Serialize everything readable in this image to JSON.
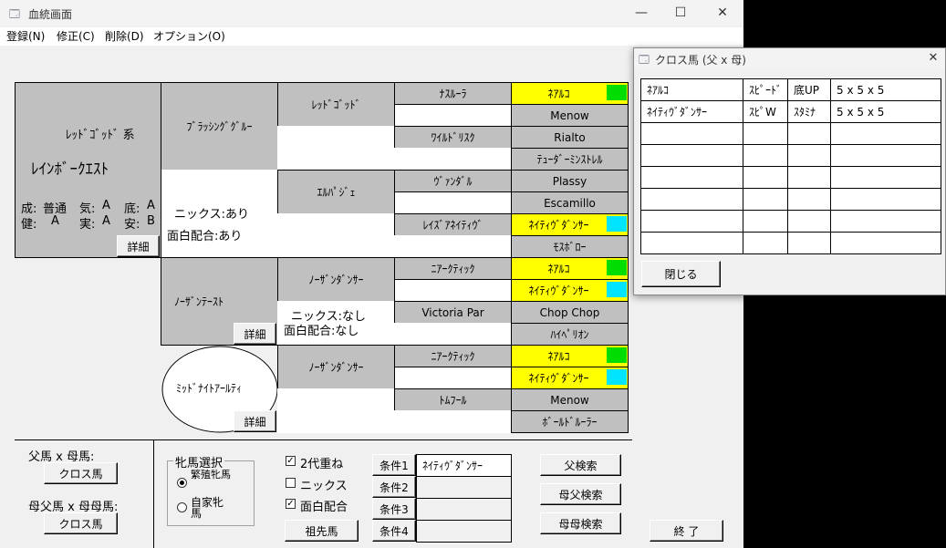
{
  "main": {
    "title": "血統画面",
    "icon": "app-window-icon",
    "controls": {
      "minimize": "—",
      "maximize": "☐",
      "close": "✕"
    },
    "menu": [
      "登録(N)",
      "修正(C)",
      "削除(D)",
      "オプション(O)"
    ]
  },
  "horse": {
    "lineage": "ﾚｯﾄﾞｺﾞｯﾄﾞ 系",
    "name": "ﾚｲﾝﾎﾞｰｸｴｽﾄ",
    "stats": {
      "seiLabel": "成:",
      "seiVal": "普通",
      "kiLabel": "気:",
      "kiVal": "A",
      "teiLabel": "底:",
      "teiVal": "A",
      "kenLabel": "健:",
      "kenVal": "A",
      "jitsuLabel": "実:",
      "jitsuVal": "A",
      "anLabel": "安:",
      "anVal": "B"
    },
    "detail": "詳細"
  },
  "sire": {
    "name": "ﾌﾞﾗｯｼﾝｸﾞｸﾞﾙｰ",
    "nicks": "ニックス:あり",
    "omoshiro": "面白配合:あり",
    "gen2": {
      "sire": "ﾚｯﾄﾞｺﾞｯﾄﾞ",
      "dam": "ｴﾙﾊﾟｼﾞｪ"
    },
    "gen3": {
      "ss": "ﾅｽﾙｰﾗ",
      "sd": "ﾜｲﾙﾄﾞﾘｽｸ",
      "ds": "ｳﾞｧﾝﾀﾞﾙ",
      "dd": "ﾚｲｽﾞｱﾈｲﾃｨｳﾞ"
    }
  },
  "dam": {
    "name": "ﾉｰｻﾞﾝﾃｰｽﾄ",
    "nicks": "ニックス:なし",
    "omoshiro": "面白配合:なし",
    "detail": "詳細",
    "gen2": {
      "sire": "ﾉｰｻﾞﾝﾀﾞﾝｻｰ"
    },
    "gen3": {
      "ss": "ﾆｱｰｸﾃｨｯｸ",
      "sd": "Victoria Par"
    }
  },
  "damdam": {
    "name": "ﾐｯﾄﾞﾅｲﾄｱｰﾙﾃｨ",
    "detail": "詳細",
    "gen2": {
      "sire": "ﾉｰｻﾞﾝﾀﾞﾝｻｰ"
    },
    "gen3": {
      "ss": "ﾆｱｰｸﾃｨｯｸ",
      "sd": "ﾄﾑﾌｰﾙ"
    }
  },
  "gen4": [
    "ﾈｱﾙｺ",
    "Menow",
    "Rialto",
    "ﾃｭｰﾀﾞｰﾐﾝｽﾄﾚﾙ",
    "Plassy",
    "Escamillo",
    "ﾈｲﾃｨｳﾞﾀﾞﾝｻｰ",
    "ﾓｽﾎﾞﾛｰ",
    "ﾈｱﾙｺ",
    "ﾈｲﾃｨｳﾞﾀﾞﾝｻｰ",
    "Chop Chop",
    "ﾊｲﾍﾟﾘｵﾝ",
    "ﾈｱﾙｺ",
    "ﾈｲﾃｨｳﾞﾀﾞﾝｻｰ",
    "Menow",
    "ﾎﾞｰﾙﾄﾞﾙｰﾗｰ"
  ],
  "colors": {
    "neatko": "#00dd00",
    "native": "#00e5ff",
    "highlight": "#ffff00",
    "gray": "#c0c0c0"
  },
  "bottom": {
    "fatherxmother": "父馬 x 母馬:",
    "cross1": "クロス馬",
    "mfxmm": "母父馬 x 母母馬:",
    "cross2": "クロス馬",
    "hinbaLabel": "牝馬選択",
    "radio1": "繁殖牝馬",
    "radio2": "自家牝馬",
    "chk2dai": "2代重ね",
    "chkNicks": "ニックス",
    "chkOmoshiro": "面白配合",
    "sosenba": "祖先馬",
    "jouken": [
      "条件1",
      "条件2",
      "条件3",
      "条件4"
    ],
    "joukenVal": [
      "ﾈｲﾃｨｳﾞﾀﾞﾝｻｰ",
      "",
      "",
      ""
    ],
    "fuSearch": "父検索",
    "boFuSearch": "母父検索",
    "boBoSearch": "母母検索",
    "end": "終 了"
  },
  "cross": {
    "title": "クロス馬 (父 x 母)",
    "rows": [
      [
        "ﾈｱﾙｺ",
        "ｽﾋﾟｰﾄﾞ",
        "底UP",
        "5 x 5 x 5"
      ],
      [
        "ﾈｲﾃｨｳﾞﾀﾞﾝｻｰ",
        "ｽﾋﾟW",
        "ｽﾀﾐﾅ",
        "5 x 5 x 5"
      ],
      [
        "",
        "",
        "",
        ""
      ],
      [
        "",
        "",
        "",
        ""
      ],
      [
        "",
        "",
        "",
        ""
      ],
      [
        "",
        "",
        "",
        ""
      ],
      [
        "",
        "",
        "",
        ""
      ],
      [
        "",
        "",
        "",
        ""
      ]
    ],
    "close": "閉じる"
  }
}
